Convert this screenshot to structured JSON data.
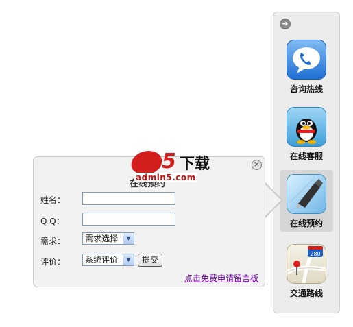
{
  "side_panel": {
    "items": [
      {
        "label": "咨询热线",
        "icon": "phone-chat-icon"
      },
      {
        "label": "在线客服",
        "icon": "qq-penguin-icon"
      },
      {
        "label": "在线预约",
        "icon": "fountain-pen-icon"
      },
      {
        "label": "交通路线",
        "icon": "map-pin-icon",
        "badge": "280"
      }
    ],
    "active_index": 2
  },
  "popup": {
    "title": "在线预约",
    "fields": {
      "name_label": "姓名：",
      "name_value": "",
      "qq_label": "Q Q：",
      "qq_value": "",
      "demand_label": "需求：",
      "demand_selected": "需求选择",
      "rating_label": "评价：",
      "rating_selected": "系统评价"
    },
    "submit_label": "提交",
    "message_link": "点击免费申请留言板",
    "close_symbol": "×"
  },
  "watermark": {
    "cn": "下载",
    "digit": "5",
    "domain": "admin5.com"
  },
  "colors": {
    "brand_red": "#d41f1f",
    "link_purple": "#660099"
  }
}
